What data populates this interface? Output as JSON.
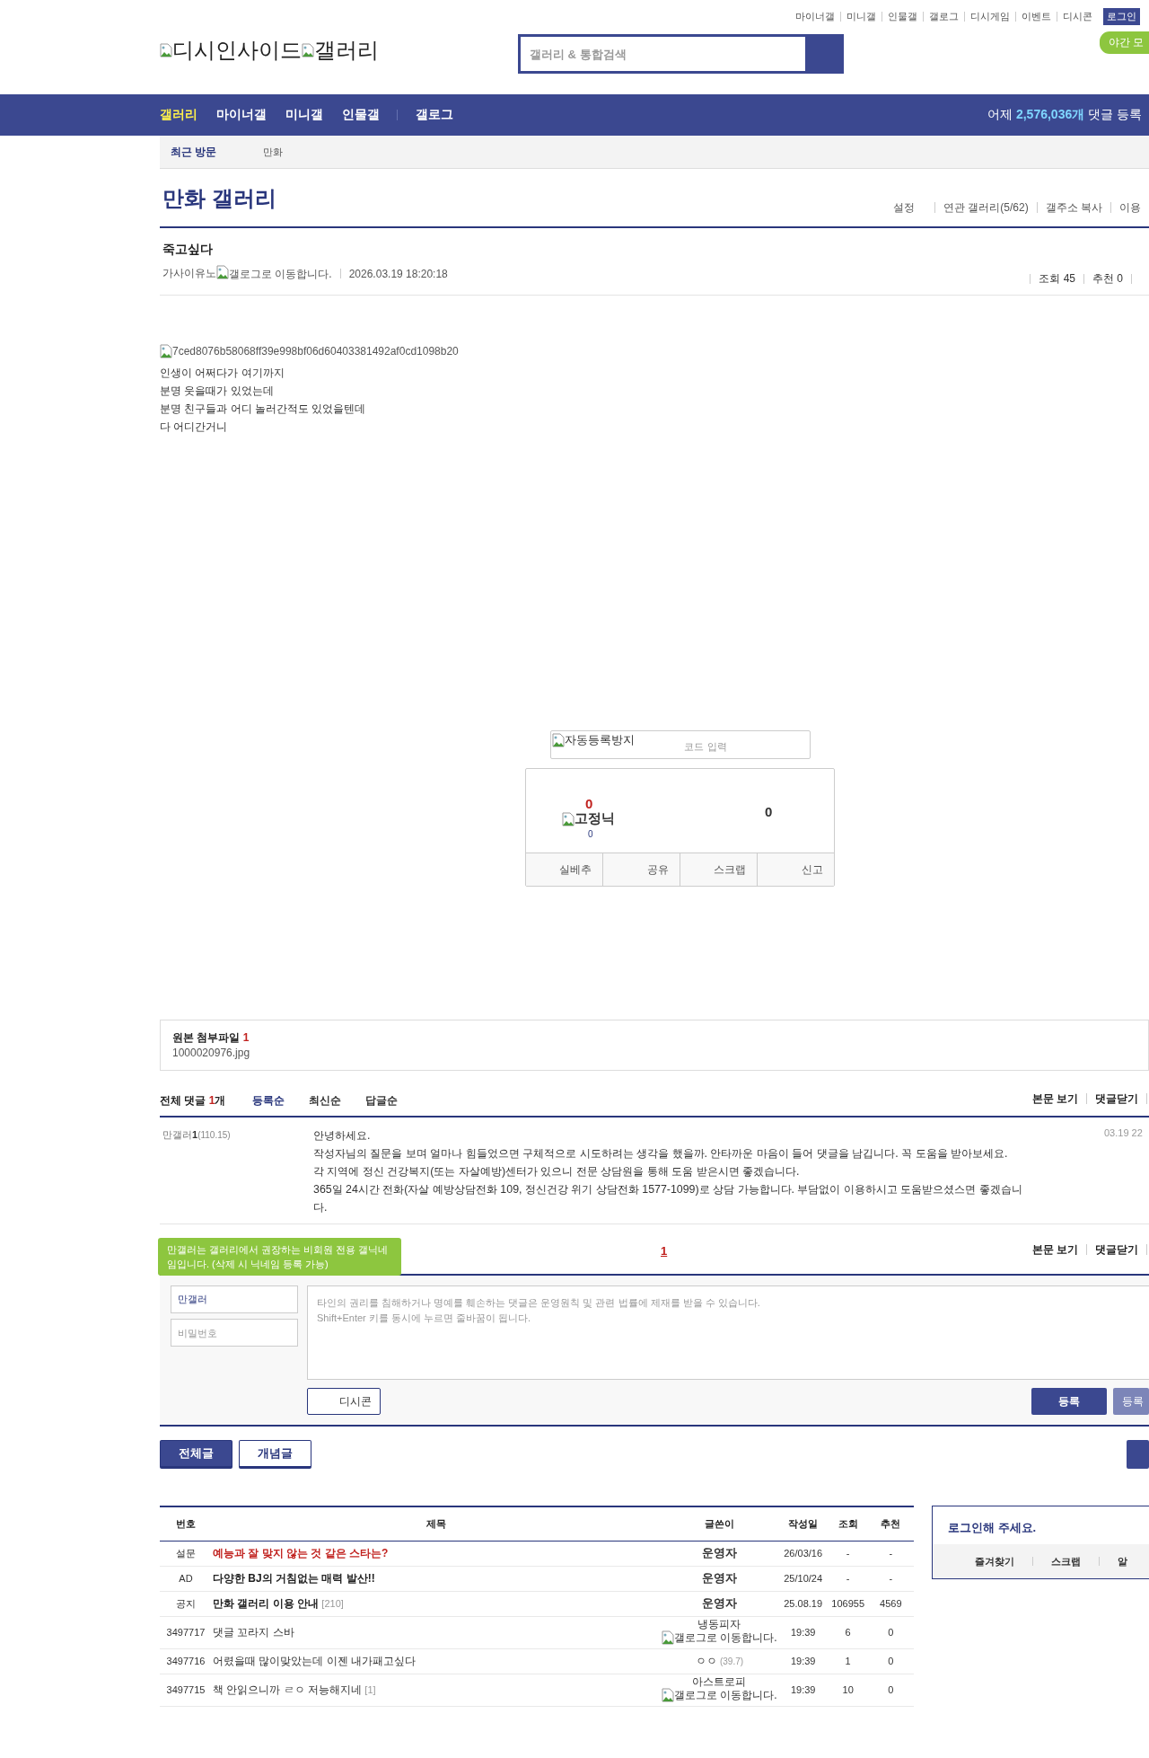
{
  "top_links": [
    "마이너갤",
    "미니갤",
    "인물갤",
    "갤로그",
    "디시게임",
    "이벤트",
    "디시콘"
  ],
  "login_button": "로그인",
  "night_mode_button": "야간 모",
  "logo": {
    "site_alt": "디시인사이드",
    "gallery_alt": "갤러리"
  },
  "search": {
    "placeholder": "갤러리 & 통합검색"
  },
  "nav": {
    "tabs": [
      {
        "label": "갤러리",
        "selected": true
      },
      {
        "label": "마이너갤",
        "selected": false
      },
      {
        "label": "미니갤",
        "selected": false
      },
      {
        "label": "인물갤",
        "selected": false
      },
      {
        "label": "갤로그",
        "selected": false
      }
    ],
    "stat_prefix": "어제",
    "stat_count": "2,576,036개",
    "stat_suffix": "댓글 등록"
  },
  "recent": {
    "label": "최근 방문",
    "items": [
      "만화"
    ]
  },
  "gallery": {
    "title": "만화 갤러리",
    "links": [
      "설정",
      "연관 갤러리(5/62)",
      "갤주소 복사",
      "이용"
    ]
  },
  "post": {
    "title": "죽고싶다",
    "author": "가사이유노",
    "author_icon_alt": "갤로그로 이동합니다.",
    "date": "2026.03.19 18:20:18",
    "views": "조회 45",
    "recommend": "추천 0",
    "image_alt": "7ced8076b58068ff39e998bf06d60403381492af0cd1098b20",
    "body": [
      "인생이 어쩌다가 여기까지",
      "분명 웃을때가 있었는데",
      "분명 친구들과 어디 놀러간적도 있었을텐데",
      "다 어디간거니"
    ]
  },
  "vote": {
    "captcha_alt": "자동등록방지",
    "captcha_placeholder": "코드 입력",
    "up_count": "0",
    "fixed_nick_alt": "고정닉",
    "fixed_nick_count": "0",
    "down_count": "0",
    "actions": [
      "실베추",
      "공유",
      "스크랩",
      "신고"
    ]
  },
  "attachment": {
    "label": "원본 첨부파일",
    "count": "1",
    "file": "1000020976.jpg"
  },
  "comments": {
    "total_label": "전체 댓글",
    "total_count": "1",
    "total_unit": "개",
    "sorts": [
      {
        "label": "등록순",
        "selected": true
      },
      {
        "label": "최신순",
        "selected": false
      },
      {
        "label": "답글순",
        "selected": false
      }
    ],
    "links": [
      "본문 보기",
      "댓글닫기"
    ],
    "items": [
      {
        "nick": "만갤러",
        "nick_num": "1",
        "ip": "(110.15)",
        "date": "03.19 22",
        "lines": [
          "안녕하세요.",
          "작성자님의 질문을 보며 얼마나 힘들었으면 구체적으로 시도하려는 생각을 했을까. 안타까운 마음이 들어 댓글을 남깁니다. 꼭 도움을 받아보세요.",
          "각 지역에 정신 건강복지(또는 자살예방)센터가 있으니 전문 상담원을 통해 도움 받은시면 좋겠습니다.",
          "365일 24시간 전화(자살 예방상담전화 109, 정신건강 위기 상담전화 1577-1099)로 상담 가능합니다. 부담없이 이용하시고 도움받으셨스면 좋겠습니다."
        ]
      }
    ],
    "pages": [
      {
        "label": "1",
        "selected": true
      }
    ],
    "bottom_links": [
      "본문 보기",
      "댓글닫기"
    ]
  },
  "form": {
    "tooltip": "만갤러는 갤러리에서 권장하는 비회원 전용 갤닉네임입니다. (삭제 시 닉네임 등록 가능)",
    "name_value": "만갤러",
    "password_placeholder": "비밀번호",
    "textarea_placeholder": "타인의 권리를 침해하거나 명예를 훼손하는 댓글은 운영원칙 및 관련 법률에 제재를 받을 수 있습니다.\nShift+Enter 키를 동시에 누르면 줄바꿈이 됩니다.",
    "dccon_button": "디시콘",
    "submit_buttons": [
      {
        "label": "등록",
        "disabled": false
      },
      {
        "label": "등록",
        "disabled": true
      }
    ]
  },
  "list_tabs": [
    {
      "label": "전체글",
      "selected": true
    },
    {
      "label": "개념글",
      "selected": false
    }
  ],
  "list": {
    "columns": [
      "번호",
      "제목",
      "글쓴이",
      "작성일",
      "조회",
      "추천"
    ],
    "rows": [
      {
        "number": "설문",
        "kind": "survey",
        "title": "예능과 잘 맞지 않는 것 같은 스타는?",
        "writer": "운영자",
        "date": "26/03/16",
        "views": "-",
        "recommend": "-"
      },
      {
        "number": "AD",
        "kind": "ad",
        "title": "다양한 BJ의 거침없는 매력 발산!!",
        "writer": "운영자",
        "date": "25/10/24",
        "views": "-",
        "recommend": "-"
      },
      {
        "number": "공지",
        "kind": "notice",
        "title": "만화 갤러리 이용 안내",
        "reply_count": "[210]",
        "writer": "운영자",
        "date": "25.08.19",
        "views": "106955",
        "recommend": "4569"
      },
      {
        "number": "3497717",
        "kind": "post",
        "title": "댓글 꼬라지 스바",
        "writer": "냉동피자",
        "writer_icon_alt": "갤로그로 이동합니다.",
        "date": "19:39",
        "views": "6",
        "recommend": "0"
      },
      {
        "number": "3497716",
        "kind": "post",
        "title": "어렸을때 많이맞았는데 이젠 내가패고싶다",
        "writer": "ㅇㅇ",
        "writer_ip": "(39.7)",
        "date": "19:39",
        "views": "1",
        "recommend": "0"
      },
      {
        "number": "3497715",
        "kind": "post",
        "title": "책 안읽으니까 ㄹㅇ 저능해지네",
        "reply_count": "[1]",
        "writer": "아스트로피",
        "writer_icon_alt": "갤로그로 이동합니다.",
        "date": "19:39",
        "views": "10",
        "recommend": "0"
      }
    ]
  },
  "side": {
    "login_prompt": "로그인해 주세요.",
    "links": [
      "즐겨찾기",
      "스크랩",
      "알"
    ]
  }
}
